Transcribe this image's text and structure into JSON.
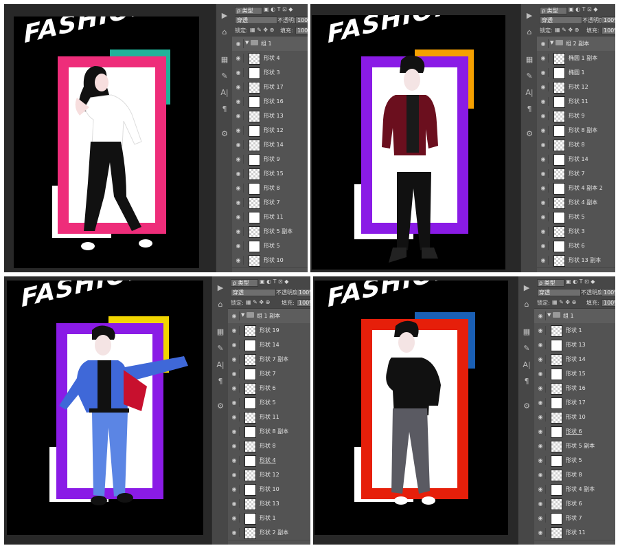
{
  "common": {
    "search_kind": "ρ 类型",
    "blend_mode": "穿透",
    "opacity_label": "不透明度:",
    "opacity_value": "100%",
    "lock_label": "锁定:",
    "fill_label": "填充:",
    "fill_value": "100%",
    "artwork_title": "FASHION"
  },
  "colors": {
    "panel_bg": "#535353",
    "canvas_bg": "#000000",
    "panel1_frame": "#ee2d7a",
    "panel1_accent": "#1fb39a",
    "panel2_frame": "#8a1be6",
    "panel2_accent": "#f5a000",
    "panel3_frame": "#8a1be6",
    "panel3_accent": "#f2d600",
    "panel4_frame": "#e61f0a",
    "panel4_accent": "#1a5fb4"
  },
  "panels": [
    {
      "layers": [
        {
          "name": "组 1",
          "group": true
        },
        {
          "name": "形状 4"
        },
        {
          "name": "形状 3"
        },
        {
          "name": "形状 17"
        },
        {
          "name": "形状 16"
        },
        {
          "name": "形状 13"
        },
        {
          "name": "形状 12"
        },
        {
          "name": "形状 14"
        },
        {
          "name": "形状 9"
        },
        {
          "name": "形状 15"
        },
        {
          "name": "形状 8"
        },
        {
          "name": "形状 7"
        },
        {
          "name": "形状 11"
        },
        {
          "name": "形状 5 副本"
        },
        {
          "name": "形状 5"
        },
        {
          "name": "形状 10"
        }
      ]
    },
    {
      "layers": [
        {
          "name": "组 2 副本",
          "group": true
        },
        {
          "name": "椭圆 1 副本"
        },
        {
          "name": "椭圆 1"
        },
        {
          "name": "形状 12"
        },
        {
          "name": "形状 11"
        },
        {
          "name": "形状 9"
        },
        {
          "name": "形状 8 副本"
        },
        {
          "name": "形状 8"
        },
        {
          "name": "形状 14"
        },
        {
          "name": "形状 7"
        },
        {
          "name": "形状 4 副本 2"
        },
        {
          "name": "形状 4 副本"
        },
        {
          "name": "形状 5"
        },
        {
          "name": "形状 3"
        },
        {
          "name": "形状 6"
        },
        {
          "name": "形状 13 副本"
        }
      ]
    },
    {
      "layers": [
        {
          "name": "组 1 副本",
          "group": true
        },
        {
          "name": "形状 19"
        },
        {
          "name": "形状 14"
        },
        {
          "name": "形状 7 副本"
        },
        {
          "name": "形状 7"
        },
        {
          "name": "形状 6"
        },
        {
          "name": "形状 5"
        },
        {
          "name": "形状 11"
        },
        {
          "name": "形状 8 副本"
        },
        {
          "name": "形状 8"
        },
        {
          "name": "形状 4",
          "underline": true
        },
        {
          "name": "形状 12"
        },
        {
          "name": "形状 10"
        },
        {
          "name": "形状 13"
        },
        {
          "name": "形状 1"
        },
        {
          "name": "形状 2 副本"
        }
      ]
    },
    {
      "layers": [
        {
          "name": "组 1",
          "group": true
        },
        {
          "name": "形状 1"
        },
        {
          "name": "形状 13"
        },
        {
          "name": "形状 14"
        },
        {
          "name": "形状 15"
        },
        {
          "name": "形状 16"
        },
        {
          "name": "形状 17"
        },
        {
          "name": "形状 10"
        },
        {
          "name": "形状 6",
          "underline": true
        },
        {
          "name": "形状 5 副本"
        },
        {
          "name": "形状 5"
        },
        {
          "name": "形状 8"
        },
        {
          "name": "形状 4 副本"
        },
        {
          "name": "形状 6"
        },
        {
          "name": "形状 7"
        },
        {
          "name": "形状 11"
        }
      ]
    }
  ]
}
